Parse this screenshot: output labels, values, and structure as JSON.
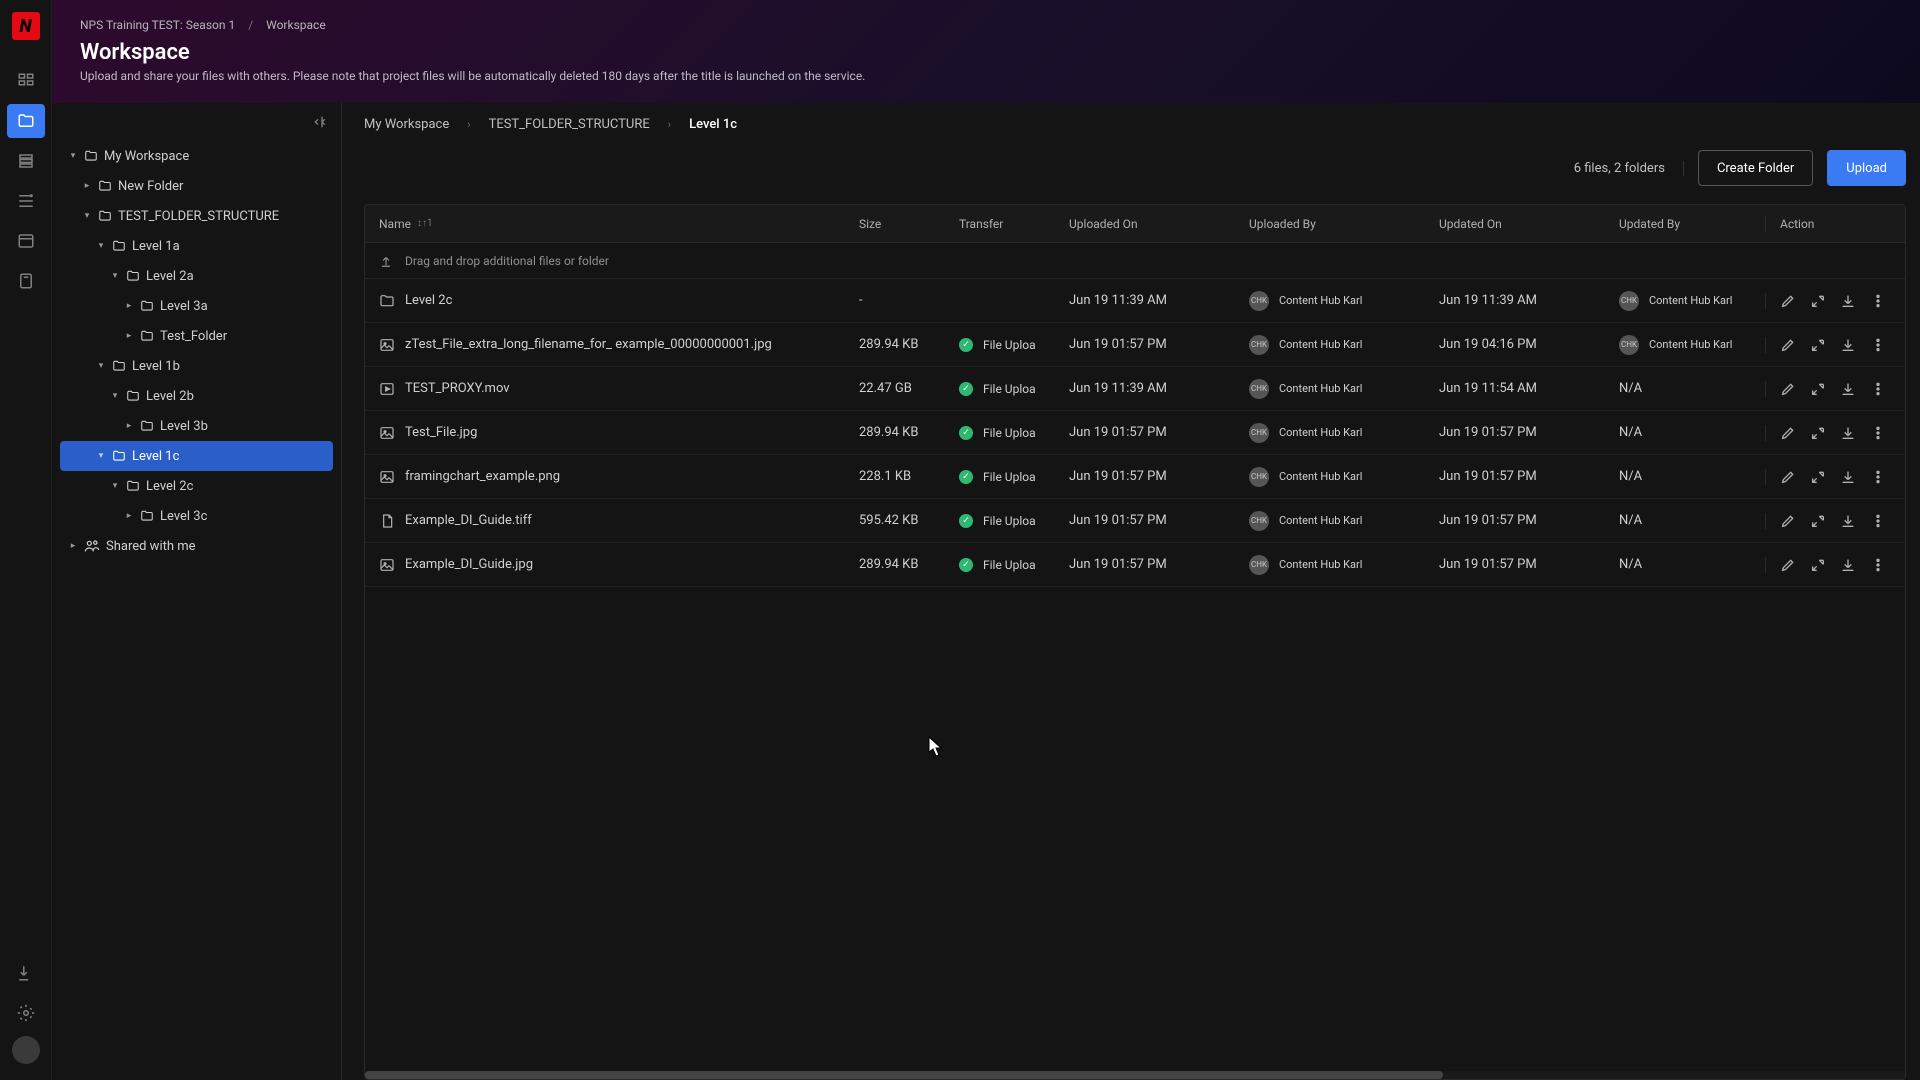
{
  "logo": "N",
  "rail": {
    "items": [
      "grid",
      "folder",
      "layers",
      "stack",
      "list",
      "clip"
    ],
    "active": 1
  },
  "header": {
    "breadcrumb": {
      "project": "NPS Training TEST: Season 1",
      "section": "Workspace"
    },
    "title": "Workspace",
    "subtitle": "Upload and share your files with others. Please note that project files will be automatically deleted 180 days after the title is launched on the service."
  },
  "tree": [
    {
      "label": "My Workspace",
      "depth": 0,
      "open": true,
      "caret": "▾",
      "icon": "folder"
    },
    {
      "label": "New Folder",
      "depth": 1,
      "open": false,
      "caret": "▸",
      "icon": "folder"
    },
    {
      "label": "TEST_FOLDER_STRUCTURE",
      "depth": 1,
      "open": true,
      "caret": "▾",
      "icon": "folder"
    },
    {
      "label": "Level 1a",
      "depth": 2,
      "open": true,
      "caret": "▾",
      "icon": "folder"
    },
    {
      "label": "Level 2a",
      "depth": 3,
      "open": true,
      "caret": "▾",
      "icon": "folder"
    },
    {
      "label": "Level 3a",
      "depth": 4,
      "open": false,
      "caret": "▸",
      "icon": "folder"
    },
    {
      "label": "Test_Folder",
      "depth": 4,
      "open": false,
      "caret": "▸",
      "icon": "folder"
    },
    {
      "label": "Level 1b",
      "depth": 2,
      "open": true,
      "caret": "▾",
      "icon": "folder"
    },
    {
      "label": "Level 2b",
      "depth": 3,
      "open": true,
      "caret": "▾",
      "icon": "folder"
    },
    {
      "label": "Level 3b",
      "depth": 4,
      "open": false,
      "caret": "▸",
      "icon": "folder"
    },
    {
      "label": "Level 1c",
      "depth": 2,
      "open": true,
      "caret": "▾",
      "icon": "folder",
      "selected": true
    },
    {
      "label": "Level 2c",
      "depth": 3,
      "open": true,
      "caret": "▾",
      "icon": "folder"
    },
    {
      "label": "Level 3c",
      "depth": 4,
      "open": false,
      "caret": "▸",
      "icon": "folder"
    },
    {
      "label": "Shared with me",
      "depth": 0,
      "open": false,
      "caret": "▸",
      "icon": "shared"
    }
  ],
  "path": [
    {
      "label": "My Workspace",
      "current": false
    },
    {
      "label": "TEST_FOLDER_STRUCTURE",
      "current": false
    },
    {
      "label": "Level 1c",
      "current": true
    }
  ],
  "toolbar": {
    "count": "6 files, 2 folders",
    "create_label": "Create Folder",
    "upload_label": "Upload"
  },
  "columns": [
    "Name",
    "Size",
    "Transfer",
    "Uploaded On",
    "Uploaded By",
    "Updated On",
    "Updated By",
    "Action"
  ],
  "sort_indicator": "↕↑1",
  "drop_hint": "Drag and drop additional files or folder",
  "user": {
    "name": "Content Hub Karl",
    "initials": "CHK"
  },
  "rows": [
    {
      "type": "folder",
      "name": "Level 2c",
      "size": "-",
      "transfer": "",
      "uploaded_on": "Jun 19 11:39 AM",
      "uploaded_by": "Content Hub Karl",
      "updated_on": "Jun 19 11:39 AM",
      "updated_by": "Content Hub Karl"
    },
    {
      "type": "image",
      "name": "zTest_File_extra_long_filename_for_ example_00000000001.jpg",
      "size": "289.94 KB",
      "transfer": "File Uploa",
      "uploaded_on": "Jun 19 01:57 PM",
      "uploaded_by": "Content Hub Karl",
      "updated_on": "Jun 19 04:16 PM",
      "updated_by": "Content Hub Karl"
    },
    {
      "type": "video",
      "name": "TEST_PROXY.mov",
      "size": "22.47 GB",
      "transfer": "File Uploa",
      "uploaded_on": "Jun 19 11:39 AM",
      "uploaded_by": "Content Hub Karl",
      "updated_on": "Jun 19 11:54 AM",
      "updated_by": "N/A"
    },
    {
      "type": "image",
      "name": "Test_File.jpg",
      "size": "289.94 KB",
      "transfer": "File Uploa",
      "uploaded_on": "Jun 19 01:57 PM",
      "uploaded_by": "Content Hub Karl",
      "updated_on": "Jun 19 01:57 PM",
      "updated_by": "N/A"
    },
    {
      "type": "image",
      "name": "framingchart_example.png",
      "size": "228.1 KB",
      "transfer": "File Uploa",
      "uploaded_on": "Jun 19 01:57 PM",
      "uploaded_by": "Content Hub Karl",
      "updated_on": "Jun 19 01:57 PM",
      "updated_by": "N/A"
    },
    {
      "type": "file",
      "name": "Example_DI_Guide.tiff",
      "size": "595.42 KB",
      "transfer": "File Uploa",
      "uploaded_on": "Jun 19 01:57 PM",
      "uploaded_by": "Content Hub Karl",
      "updated_on": "Jun 19 01:57 PM",
      "updated_by": "N/A"
    },
    {
      "type": "image",
      "name": "Example_DI_Guide.jpg",
      "size": "289.94 KB",
      "transfer": "File Uploa",
      "uploaded_on": "Jun 19 01:57 PM",
      "uploaded_by": "Content Hub Karl",
      "updated_on": "Jun 19 01:57 PM",
      "updated_by": "N/A"
    }
  ]
}
